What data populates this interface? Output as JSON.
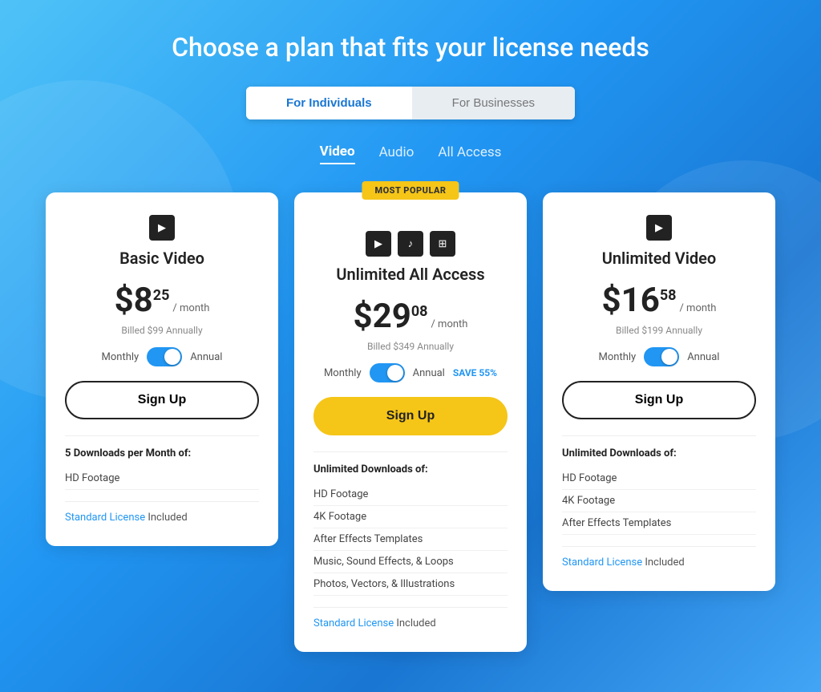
{
  "page": {
    "title": "Choose a plan that fits your license needs"
  },
  "tabs": {
    "individuals_label": "For Individuals",
    "businesses_label": "For Businesses"
  },
  "category_tabs": [
    {
      "label": "Video",
      "active": true
    },
    {
      "label": "Audio",
      "active": false
    },
    {
      "label": "All Access",
      "active": false
    }
  ],
  "cards": [
    {
      "id": "basic-video",
      "featured": false,
      "title": "Basic Video",
      "icons": [
        "▶"
      ],
      "price_main": "$8",
      "price_cents": "25",
      "price_period": "/ month",
      "billed": "Billed $99 Annually",
      "toggle_left": "Monthly",
      "toggle_right": "Annual",
      "save_badge": "",
      "signup_label": "Sign Up",
      "features_title": "5 Downloads per Month of:",
      "features": [
        "HD Footage"
      ],
      "license_link": "Standard License",
      "license_suffix": " Included"
    },
    {
      "id": "unlimited-all-access",
      "featured": true,
      "most_popular": "MOST POPULAR",
      "title": "Unlimited All Access",
      "icons": [
        "▶",
        "♪",
        "⊞"
      ],
      "price_main": "$29",
      "price_cents": "08",
      "price_period": "/ month",
      "billed": "Billed $349 Annually",
      "toggle_left": "Monthly",
      "toggle_right": "Annual",
      "save_badge": "SAVE 55%",
      "signup_label": "Sign Up",
      "features_title": "Unlimited Downloads of:",
      "features": [
        "HD Footage",
        "4K Footage",
        "After Effects Templates",
        "Music, Sound Effects, & Loops",
        "Photos, Vectors, & Illustrations"
      ],
      "license_link": "Standard License",
      "license_suffix": " Included"
    },
    {
      "id": "unlimited-video",
      "featured": false,
      "title": "Unlimited Video",
      "icons": [
        "▶"
      ],
      "price_main": "$16",
      "price_cents": "58",
      "price_period": "/ month",
      "billed": "Billed $199 Annually",
      "toggle_left": "Monthly",
      "toggle_right": "Annual",
      "save_badge": "",
      "signup_label": "Sign Up",
      "features_title": "Unlimited Downloads of:",
      "features": [
        "HD Footage",
        "4K Footage",
        "After Effects Templates"
      ],
      "license_link": "Standard License",
      "license_suffix": " Included"
    }
  ]
}
